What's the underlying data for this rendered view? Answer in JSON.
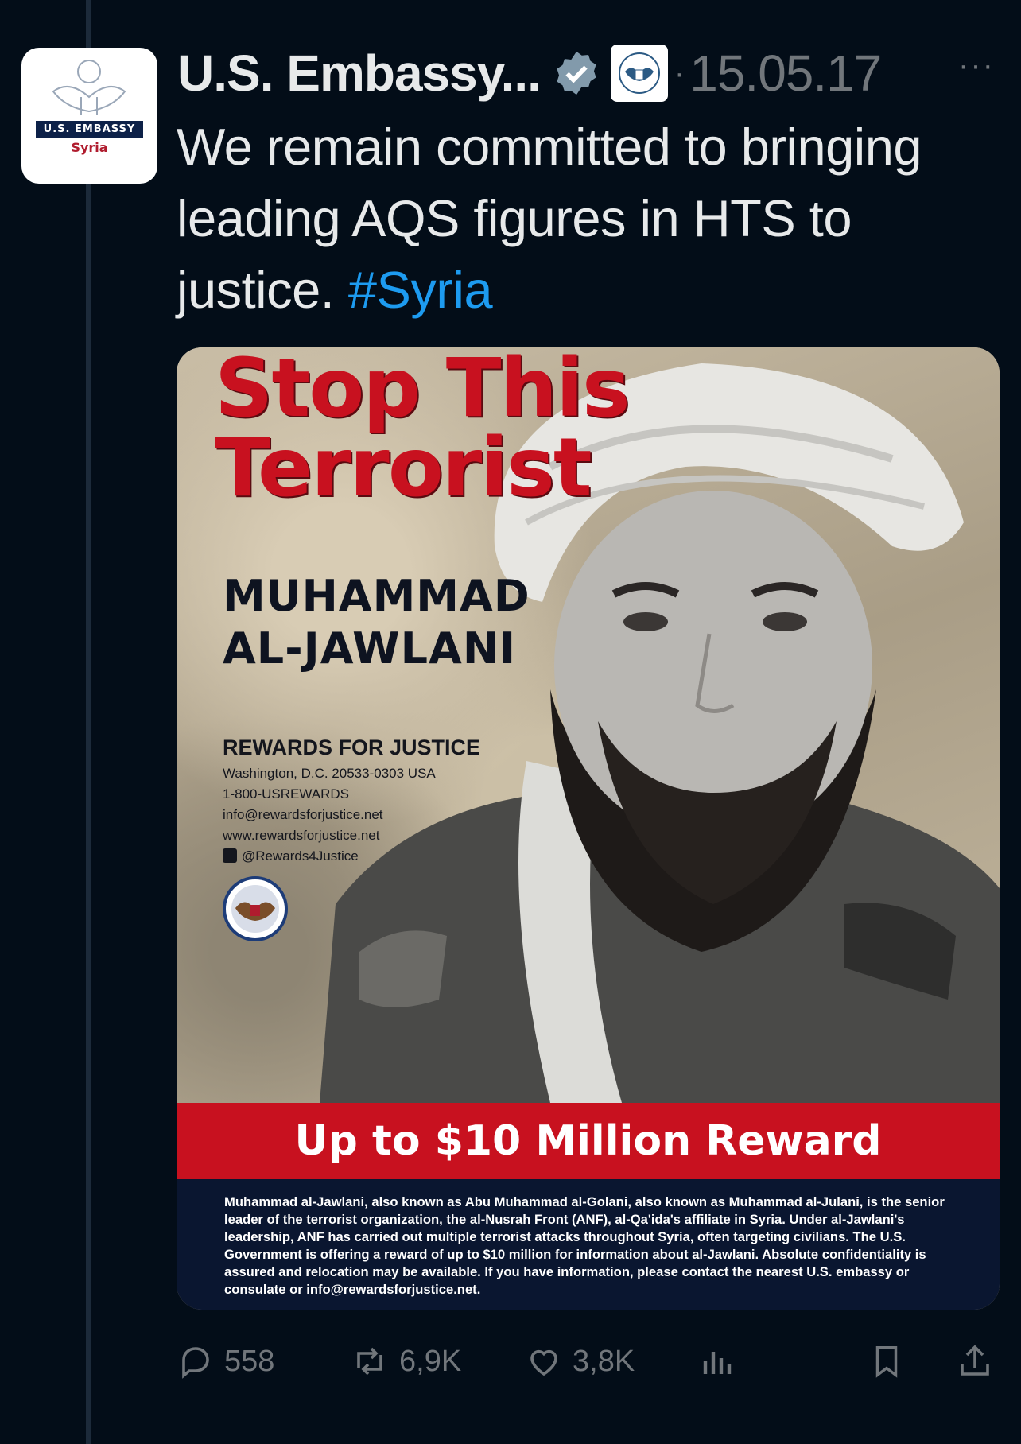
{
  "tweet": {
    "author": "U.S. Embassy...",
    "date": "15.05.17",
    "separator": "·",
    "more": "···",
    "text_main": "We remain committed to bringing leading AQS figures in HTS to justice. ",
    "hashtag": "#Syria",
    "avatar": {
      "line1": "U.S. EMBASSY",
      "line2": "Syria"
    }
  },
  "media": {
    "headline": "Stop This Terrorist",
    "name_line1": "MUHAMMAD",
    "name_line2": "AL-JAWLANI",
    "rfj_title": "REWARDS FOR JUSTICE",
    "rfj_address": "Washington, D.C. 20533-0303 USA",
    "rfj_phone": "1-800-USREWARDS",
    "rfj_email": "info@rewardsforjustice.net",
    "rfj_web": "www.rewardsforjustice.net",
    "rfj_twitter": "@Rewards4Justice",
    "reward": "Up to $10 Million Reward",
    "description": "Muhammad al-Jawlani, also known as Abu Muhammad al-Golani, also known as Muhammad al-Julani, is the senior leader of the terrorist organization, the al-Nusrah Front (ANF), al-Qa'ida's affiliate in Syria. Under al-Jawlani's leadership, ANF has carried out multiple terrorist attacks throughout Syria, often targeting civilians. The U.S. Government is offering a reward of up to $10 million for information about al-Jawlani. Absolute confidentiality is assured and relocation may be available. If you have information, please contact the nearest U.S. embassy or consulate or info@rewardsforjustice.net."
  },
  "actions": {
    "replies": "558",
    "reposts": "6,9K",
    "likes": "3,8K"
  },
  "colors": {
    "background": "#030d18",
    "accent": "#1d9bf0",
    "muted": "#71767b",
    "poster_red": "#c8111f"
  }
}
